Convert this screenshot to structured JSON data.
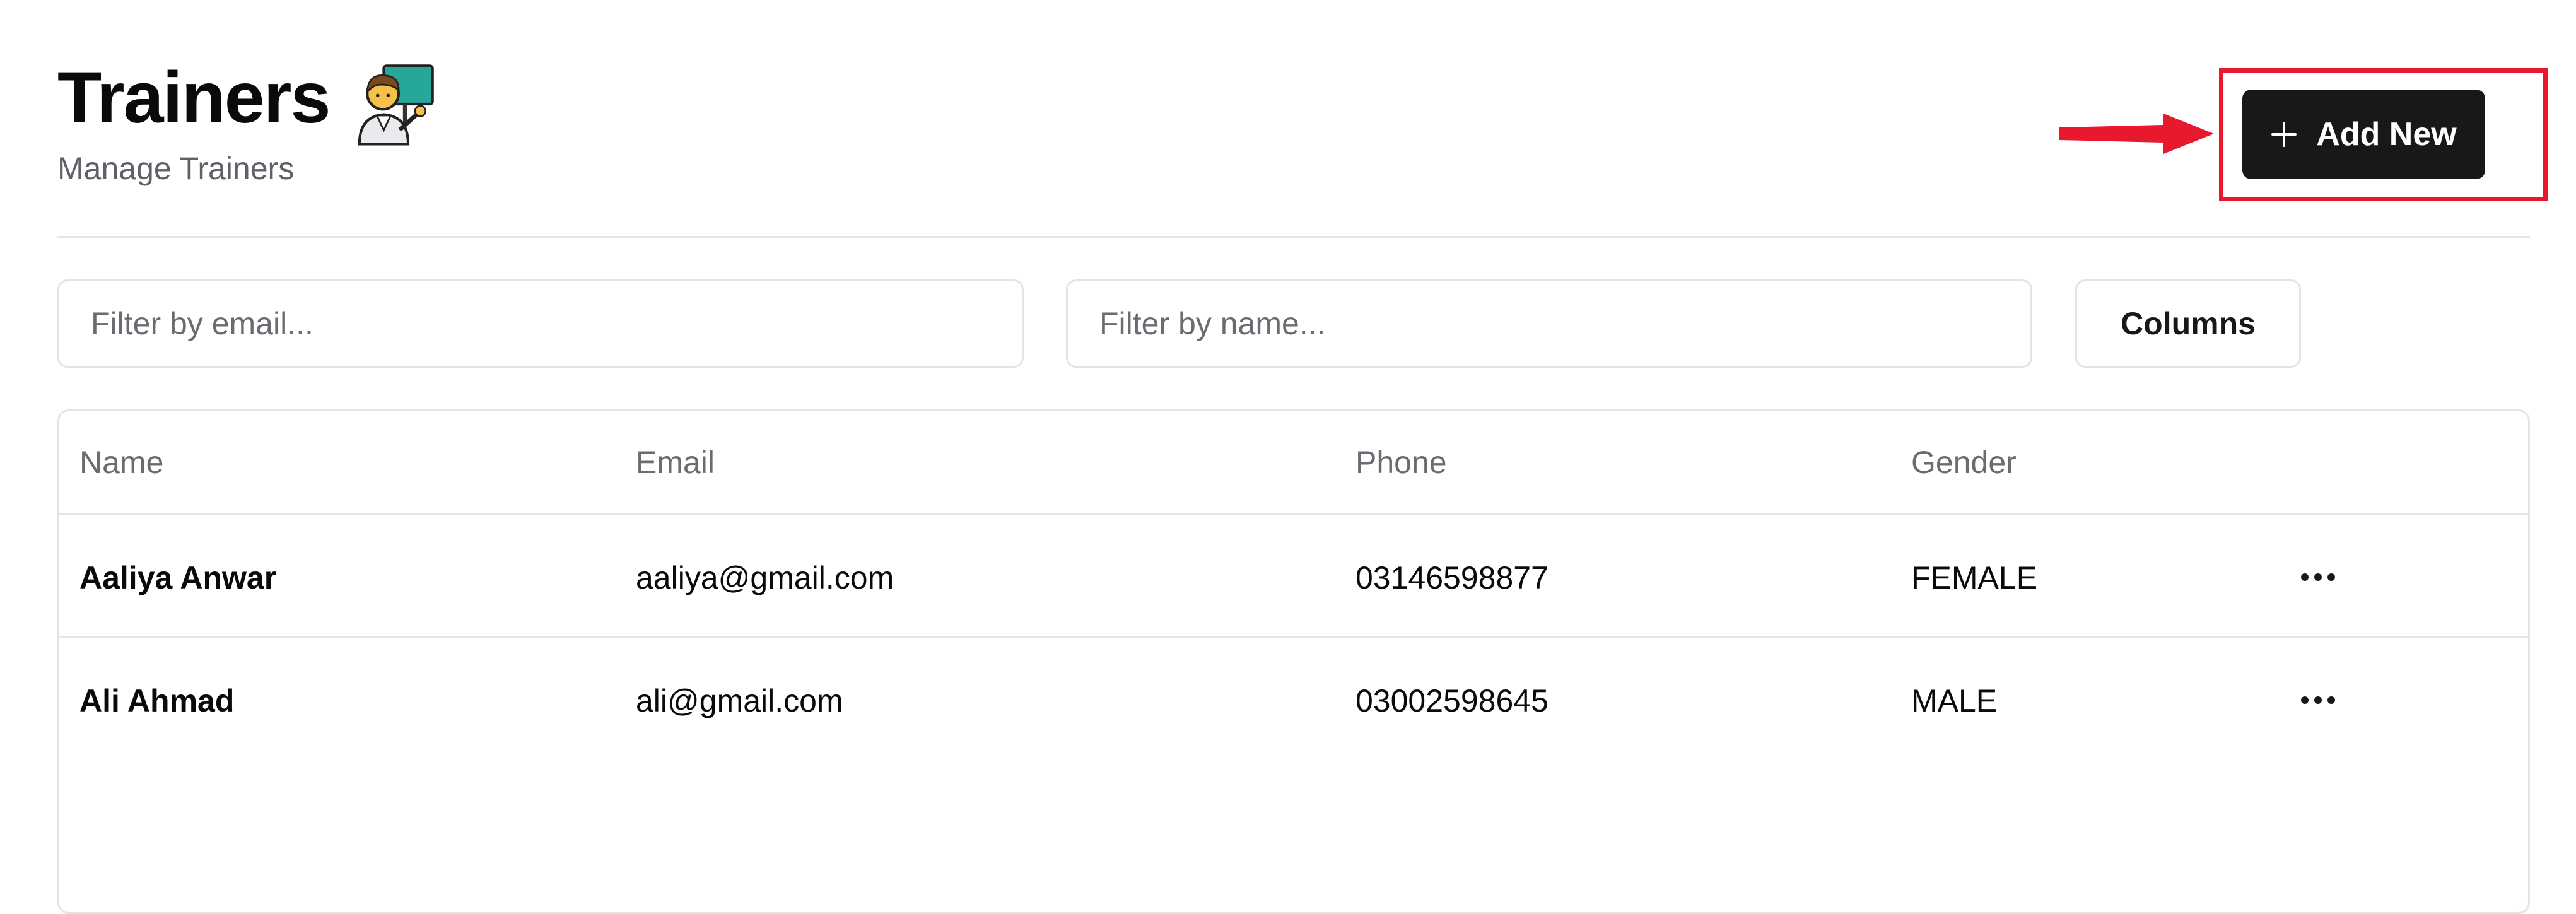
{
  "page": {
    "title": "Trainers",
    "subtitle": "Manage Trainers",
    "title_icon": "teacher-emoji-icon"
  },
  "actions": {
    "add_new_label": "Add New",
    "add_new_icon": "plus-icon",
    "columns_label": "Columns"
  },
  "filters": {
    "email_placeholder": "Filter by email...",
    "email_value": "",
    "name_placeholder": "Filter by name...",
    "name_value": ""
  },
  "table": {
    "headers": [
      "Name",
      "Email",
      "Phone",
      "Gender"
    ],
    "rows": [
      {
        "name": "Aaliya Anwar",
        "email": "aaliya@gmail.com",
        "phone": "03146598877",
        "gender": "FEMALE"
      },
      {
        "name": "Ali Ahmad",
        "email": "ali@gmail.com",
        "phone": "03002598645",
        "gender": "MALE"
      }
    ],
    "row_action_icon": "more-horizontal-icon"
  },
  "annotation": {
    "arrow_icon": "red-arrow-icon",
    "highlight_color": "#e8192c"
  },
  "colors": {
    "primary_button": "#18181b",
    "border": "#e4e4e7",
    "muted_text": "#6b6b72"
  }
}
